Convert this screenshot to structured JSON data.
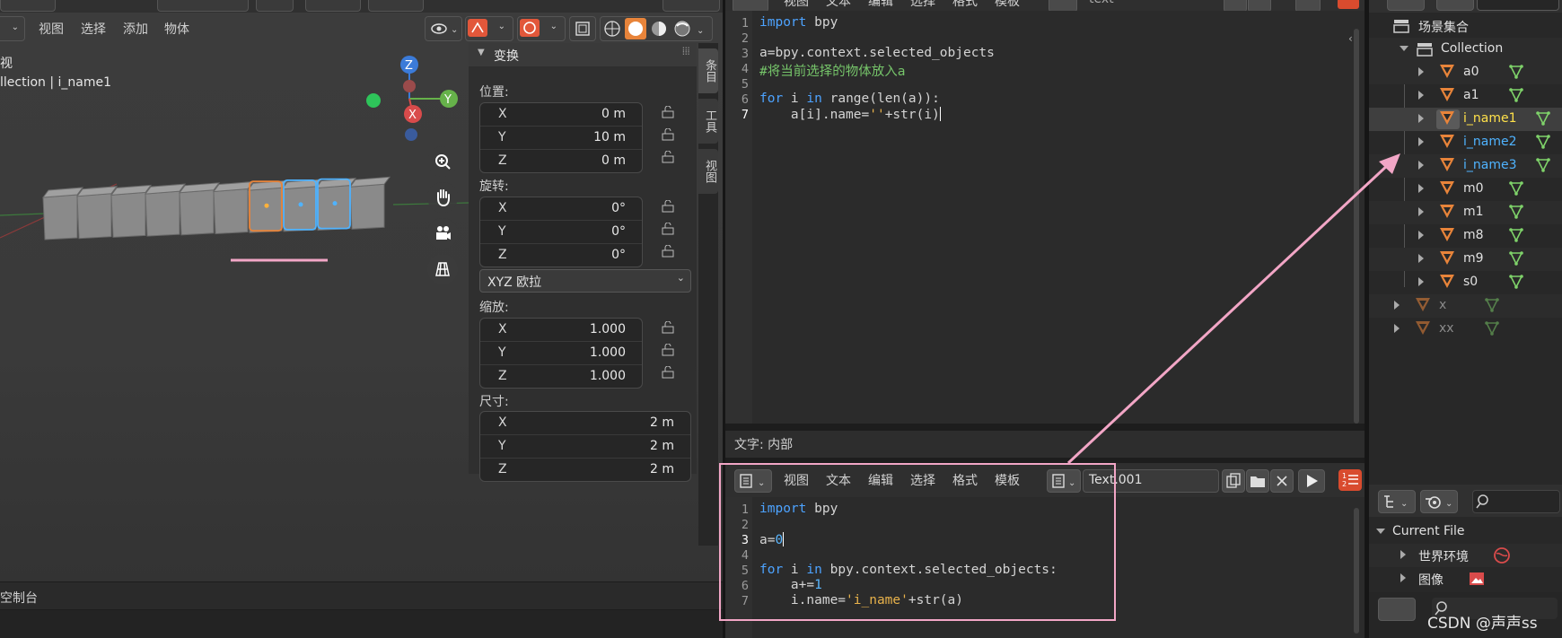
{
  "viewport": {
    "header_menus": [
      "视图",
      "选择",
      "添加",
      "物体"
    ],
    "overlay_title_partial": "视",
    "overlay_collection": "llection | i_name1",
    "gizmo_axes": [
      "Z",
      "Y",
      "X"
    ],
    "selected_cube_index": 6
  },
  "npanel": {
    "panel_title": "变换",
    "location_label": "位置:",
    "location": [
      {
        "axis": "X",
        "value": "0 m"
      },
      {
        "axis": "Y",
        "value": "10 m"
      },
      {
        "axis": "Z",
        "value": "0 m"
      }
    ],
    "rotation_label": "旋转:",
    "rotation": [
      {
        "axis": "X",
        "value": "0°"
      },
      {
        "axis": "Y",
        "value": "0°"
      },
      {
        "axis": "Z",
        "value": "0°"
      }
    ],
    "rotation_mode": "XYZ 欧拉",
    "scale_label": "缩放:",
    "scale": [
      {
        "axis": "X",
        "value": "1.000"
      },
      {
        "axis": "Y",
        "value": "1.000"
      },
      {
        "axis": "Z",
        "value": "1.000"
      }
    ],
    "dimensions_label": "尺寸:",
    "dimensions": [
      {
        "axis": "X",
        "value": "2 m"
      },
      {
        "axis": "Y",
        "value": "2 m"
      },
      {
        "axis": "Z",
        "value": "2 m"
      }
    ]
  },
  "side_tabs": [
    "条目",
    "工具",
    "视图"
  ],
  "console": {
    "label": "控制台",
    "label_partial": "空制台"
  },
  "editor_top": {
    "menus": [
      "视图",
      "文本",
      "编辑",
      "选择",
      "格式",
      "模板"
    ],
    "text_name": "text",
    "status": "文字: 内部",
    "lines": [
      {
        "n": "1",
        "code": "import bpy"
      },
      {
        "n": "2",
        "code": ""
      },
      {
        "n": "3",
        "code": "a=bpy.context.selected_objects"
      },
      {
        "n": "4",
        "code": "#将当前选择的物体放入a"
      },
      {
        "n": "5",
        "code": ""
      },
      {
        "n": "6",
        "code": "for i in range(len(a)):"
      },
      {
        "n": "7",
        "code": "    a[i].name=''+str(i)"
      }
    ]
  },
  "editor_bottom": {
    "menus": [
      "视图",
      "文本",
      "编辑",
      "选择",
      "格式",
      "模板"
    ],
    "text_name": "Text.001",
    "lines": [
      {
        "n": "1",
        "code": "import bpy"
      },
      {
        "n": "2",
        "code": ""
      },
      {
        "n": "3",
        "code": "a=0"
      },
      {
        "n": "4",
        "code": ""
      },
      {
        "n": "5",
        "code": "for i in bpy.context.selected_objects:"
      },
      {
        "n": "6",
        "code": "    a+=1"
      },
      {
        "n": "7",
        "code": "    i.name='i_name'+str(a)"
      }
    ]
  },
  "outliner": {
    "scene_collection": "场景集合",
    "collection": "Collection",
    "objects": [
      {
        "name": "a0",
        "state": "normal"
      },
      {
        "name": "a1",
        "state": "normal"
      },
      {
        "name": "i_name1",
        "state": "active"
      },
      {
        "name": "i_name2",
        "state": "selected"
      },
      {
        "name": "i_name3",
        "state": "selected"
      },
      {
        "name": "m0",
        "state": "normal"
      },
      {
        "name": "m1",
        "state": "normal"
      },
      {
        "name": "m8",
        "state": "normal"
      },
      {
        "name": "m9",
        "state": "normal"
      },
      {
        "name": "s0",
        "state": "normal"
      },
      {
        "name": "x",
        "state": "excluded"
      },
      {
        "name": "xx",
        "state": "excluded"
      }
    ],
    "current_file": "Current File",
    "file_items": [
      "世界环境",
      "图像"
    ]
  },
  "watermark": "CSDN @声声ss",
  "colors": {
    "active_text": "#ffe14a",
    "selected_text": "#4fb3ff",
    "mesh_orange": "#e8843a",
    "mesh_data_green": "#7fd36a",
    "annotation_pink": "#f2a6c6"
  }
}
